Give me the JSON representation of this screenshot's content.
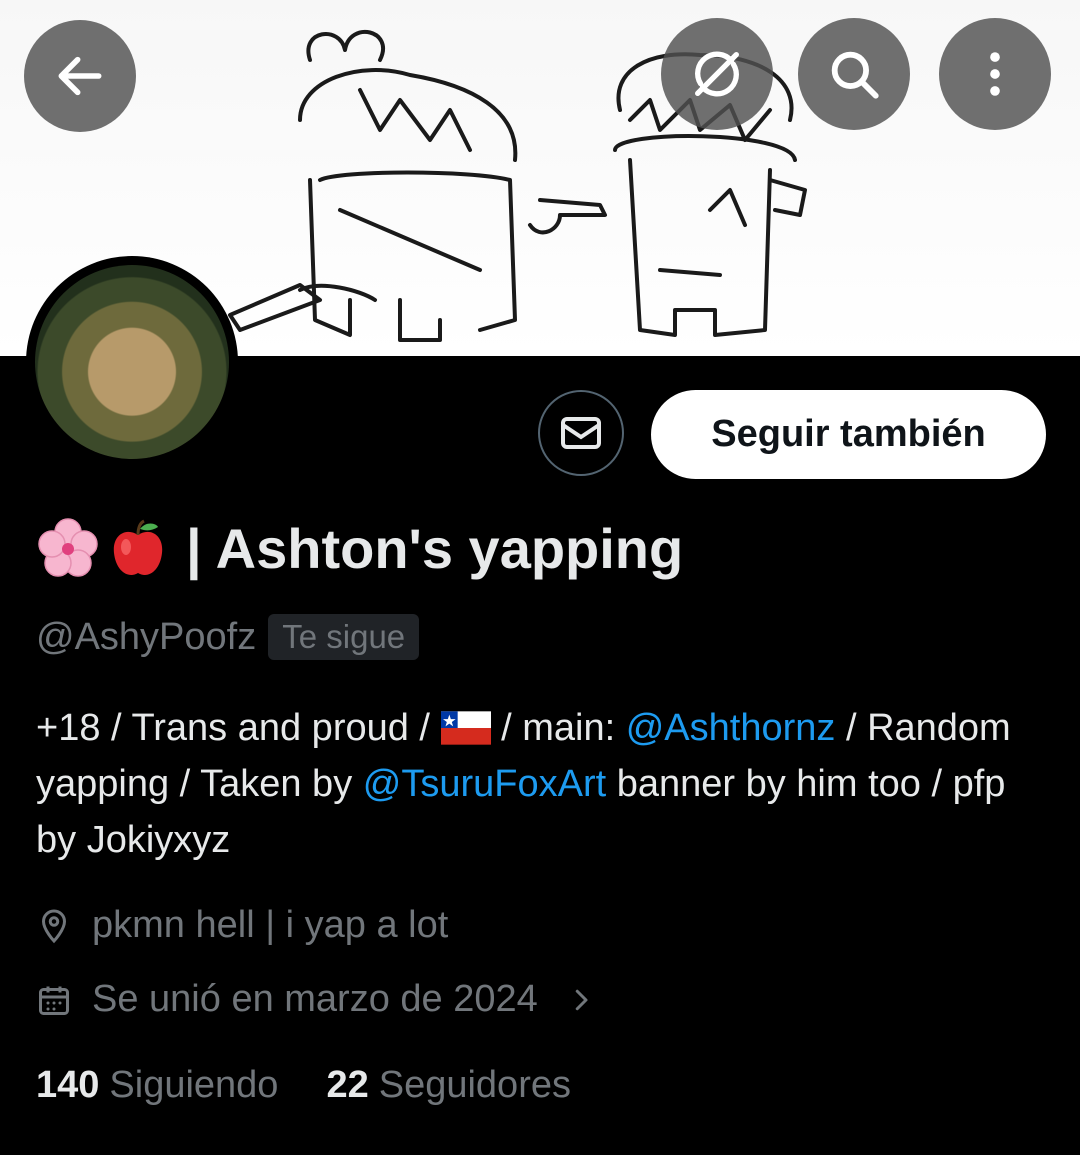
{
  "header": {
    "back_icon": "arrow-left-icon",
    "grok_icon": "grok-icon",
    "search_icon": "search-icon",
    "more_icon": "more-vertical-icon"
  },
  "profile": {
    "display_name_emojis": [
      "cherry-blossom-icon",
      "red-apple-icon"
    ],
    "display_name_sep": "|",
    "display_name": "Ashton's yapping",
    "handle": "@AshyPoofz",
    "follows_you_badge": "Te sigue",
    "message_icon": "envelope-icon",
    "follow_label": "Seguir también",
    "bio": {
      "part1": "+18 / Trans and proud / ",
      "flag": "chile-flag-icon",
      "part2": " / main: ",
      "mention1": "@Ashthornz",
      "part3": " / Random yapping / Taken by ",
      "mention2": "@TsuruFoxArt",
      "part4": " banner by him too / pfp by Jokiyxyz"
    },
    "location": "pkmn hell | i yap a lot",
    "joined": "Se unió en marzo de 2024",
    "following_count": "140",
    "following_label": "Siguiendo",
    "followers_count": "22",
    "followers_label": "Seguidores"
  },
  "colors": {
    "background": "#000000",
    "text_primary": "#e7e9ea",
    "text_secondary": "#71767b",
    "link": "#1d9bf0",
    "button_bg": "#ffffff"
  }
}
